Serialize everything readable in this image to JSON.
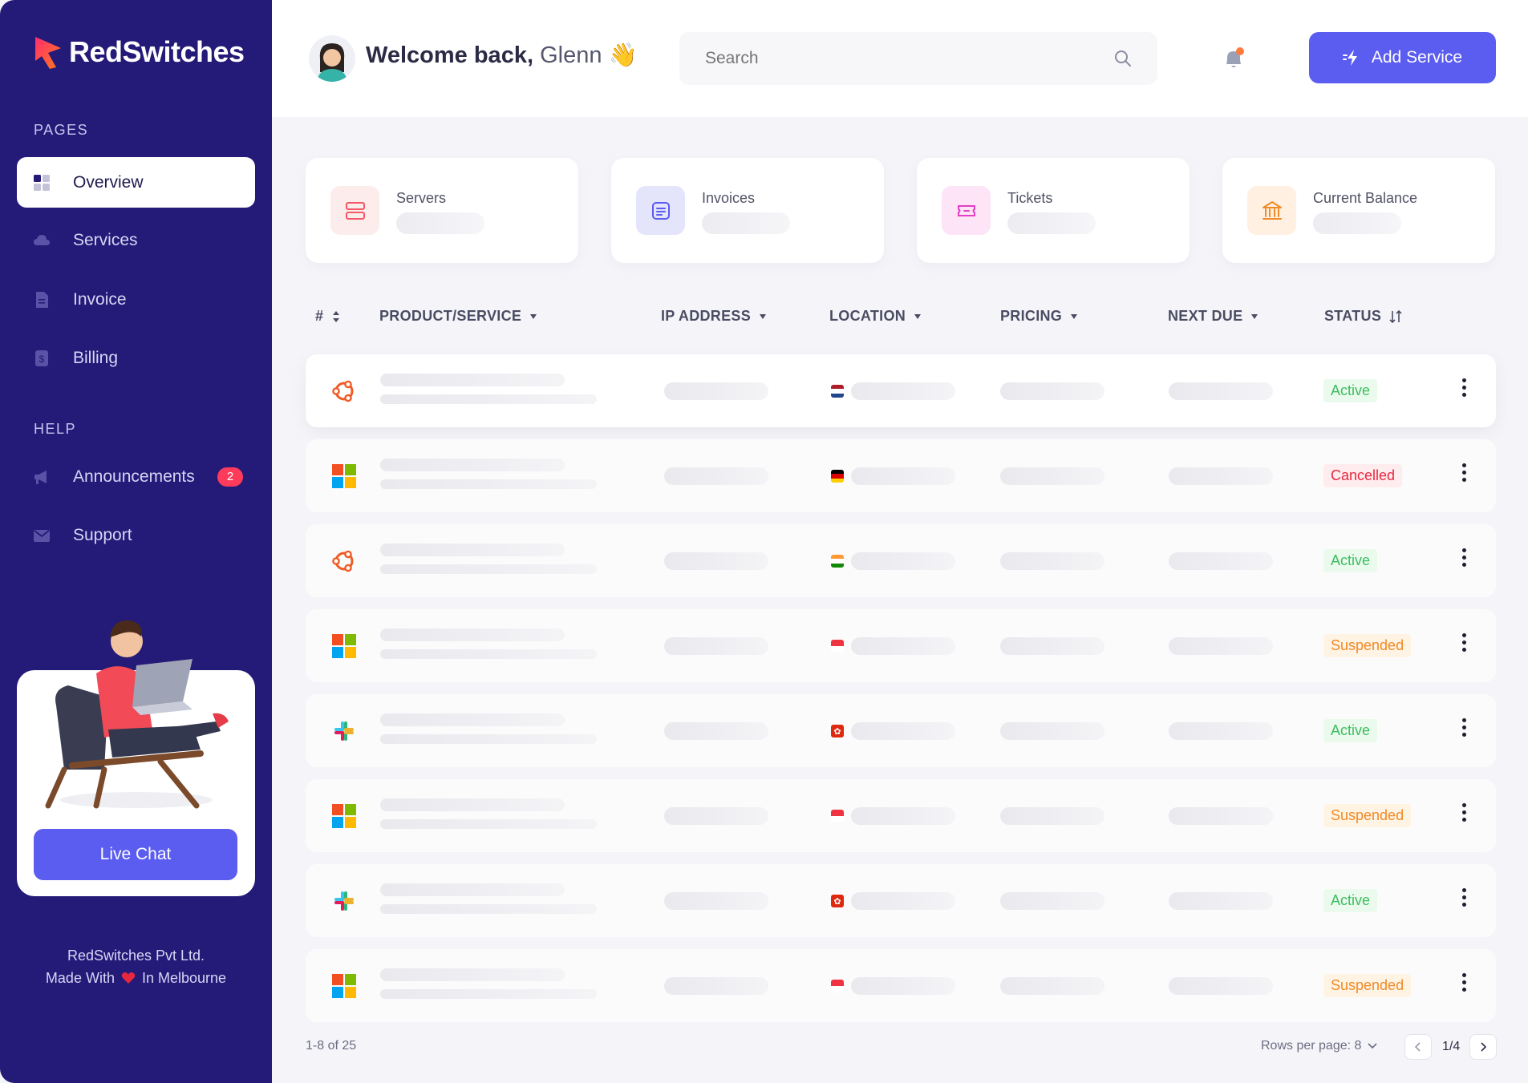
{
  "brand": {
    "name": "RedSwitches"
  },
  "sidebar": {
    "pages_label": "PAGES",
    "help_label": "HELP",
    "items": [
      {
        "label": "Overview",
        "icon": "dashboard-icon",
        "active": true
      },
      {
        "label": "Services",
        "icon": "cloud-icon"
      },
      {
        "label": "Invoice",
        "icon": "document-icon"
      },
      {
        "label": "Billing",
        "icon": "dollar-icon"
      }
    ],
    "help_items": [
      {
        "label": "Announcements",
        "icon": "megaphone-icon",
        "badge": "2"
      },
      {
        "label": "Support",
        "icon": "mail-icon"
      }
    ],
    "live_chat_label": "Live Chat",
    "footer_line1": "RedSwitches Pvt Ltd.",
    "footer_line2_pre": "Made With",
    "footer_line2_post": "In Melbourne"
  },
  "header": {
    "welcome_prefix": "Welcome back,",
    "user_name": "Glenn",
    "wave_emoji": "👋",
    "search_placeholder": "Search",
    "add_service_label": "Add Service"
  },
  "stats": [
    {
      "label": "Servers",
      "icon": "server-icon",
      "color": "#fdecec"
    },
    {
      "label": "Invoices",
      "icon": "invoice-icon",
      "color": "#e4e4fb"
    },
    {
      "label": "Tickets",
      "icon": "ticket-icon",
      "color": "#fde4f6"
    },
    {
      "label": "Current Balance",
      "icon": "bank-icon",
      "color": "#fff0e2"
    }
  ],
  "table": {
    "columns": [
      "#",
      "PRODUCT/SERVICE",
      "IP ADDRESS",
      "LOCATION",
      "PRICING",
      "NEXT DUE",
      "STATUS"
    ],
    "rows": [
      {
        "os": "ubuntu",
        "flag": "nl",
        "status": "Active"
      },
      {
        "os": "windows",
        "flag": "de",
        "status": "Cancelled"
      },
      {
        "os": "ubuntu",
        "flag": "in",
        "status": "Active"
      },
      {
        "os": "windows",
        "flag": "sg",
        "status": "Suspended"
      },
      {
        "os": "slack",
        "flag": "hk",
        "status": "Active"
      },
      {
        "os": "windows",
        "flag": "sg",
        "status": "Suspended"
      },
      {
        "os": "slack",
        "flag": "hk",
        "status": "Active"
      },
      {
        "os": "windows",
        "flag": "sg",
        "status": "Suspended"
      }
    ]
  },
  "pagination": {
    "range": "1-8 of 25",
    "rows_per_page": "Rows per page: 8",
    "page": "1/4"
  },
  "colors": {
    "sidebar_bg": "#241a78",
    "accent": "#5b5cf0",
    "active_green": "#3dbd5f",
    "cancelled_red": "#e5283e",
    "suspended_orange": "#f08a26"
  }
}
